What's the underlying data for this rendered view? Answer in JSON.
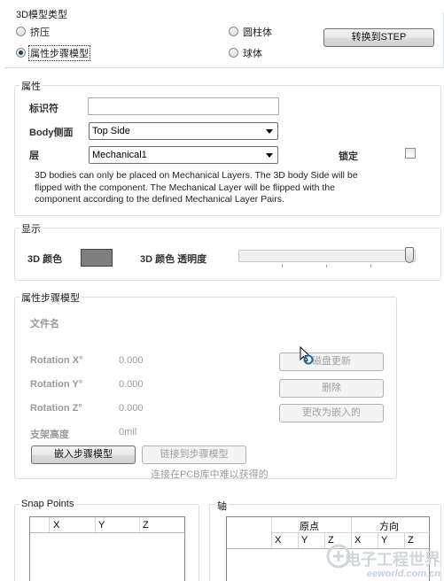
{
  "model_type": {
    "title": "3D模型类型",
    "options": [
      {
        "label": "挤压",
        "selected": false
      },
      {
        "label": "圆柱体",
        "selected": false
      },
      {
        "label": "属性步骤模型",
        "selected": true
      },
      {
        "label": "球体",
        "selected": false
      }
    ],
    "convert_button": "转换到STEP"
  },
  "properties": {
    "title": "属性",
    "identifier_label": "标识符",
    "identifier_value": "",
    "body_side_label": "Body侧面",
    "body_side_value": "Top Side",
    "layer_label": "层",
    "layer_value": "Mechanical1",
    "lock_label": "锁定",
    "lock_checked": false,
    "note_lines": [
      "3D bodies can only be placed on Mechanical Layers. The 3D body Side will be",
      "flipped with the component. The Mechanical Layer will be flipped with the",
      "component according to the defined Mechanical Layer Pairs."
    ]
  },
  "display": {
    "title": "显示",
    "color_label": "3D 颜色",
    "color": "#7f7f7f",
    "opacity_label": "3D 颜色 透明度",
    "opacity_fraction": 1.0
  },
  "step_model": {
    "title": "属性步骤模型",
    "filename_label": "文件名",
    "rotation_x_label": "Rotation X°",
    "rotation_x_value": "0.000",
    "rotation_y_label": "Rotation Y°",
    "rotation_y_value": "0.000",
    "rotation_z_label": "Rotation Z°",
    "rotation_z_value": "0.000",
    "standoff_label": "支架高度",
    "standoff_value": "0mil",
    "refresh_button": "磁盘更新",
    "delete_button": "删除",
    "embed_button": "更改为嵌入的",
    "embed_step_button": "嵌入步骤模型",
    "link_step_button": "链接到步骤模型",
    "link_note": "连接在PCB库中难以获得的"
  },
  "snap_points": {
    "title": "Snap Points",
    "columns": [
      "X",
      "Y",
      "Z"
    ]
  },
  "axis": {
    "title": "轴",
    "groups": [
      "原点",
      "方向"
    ],
    "columns": [
      "X",
      "Y",
      "Z",
      "X",
      "Y",
      "Z"
    ]
  },
  "watermark": {
    "text": "电子工程世界",
    "sub": "eeworld.com.cn"
  }
}
